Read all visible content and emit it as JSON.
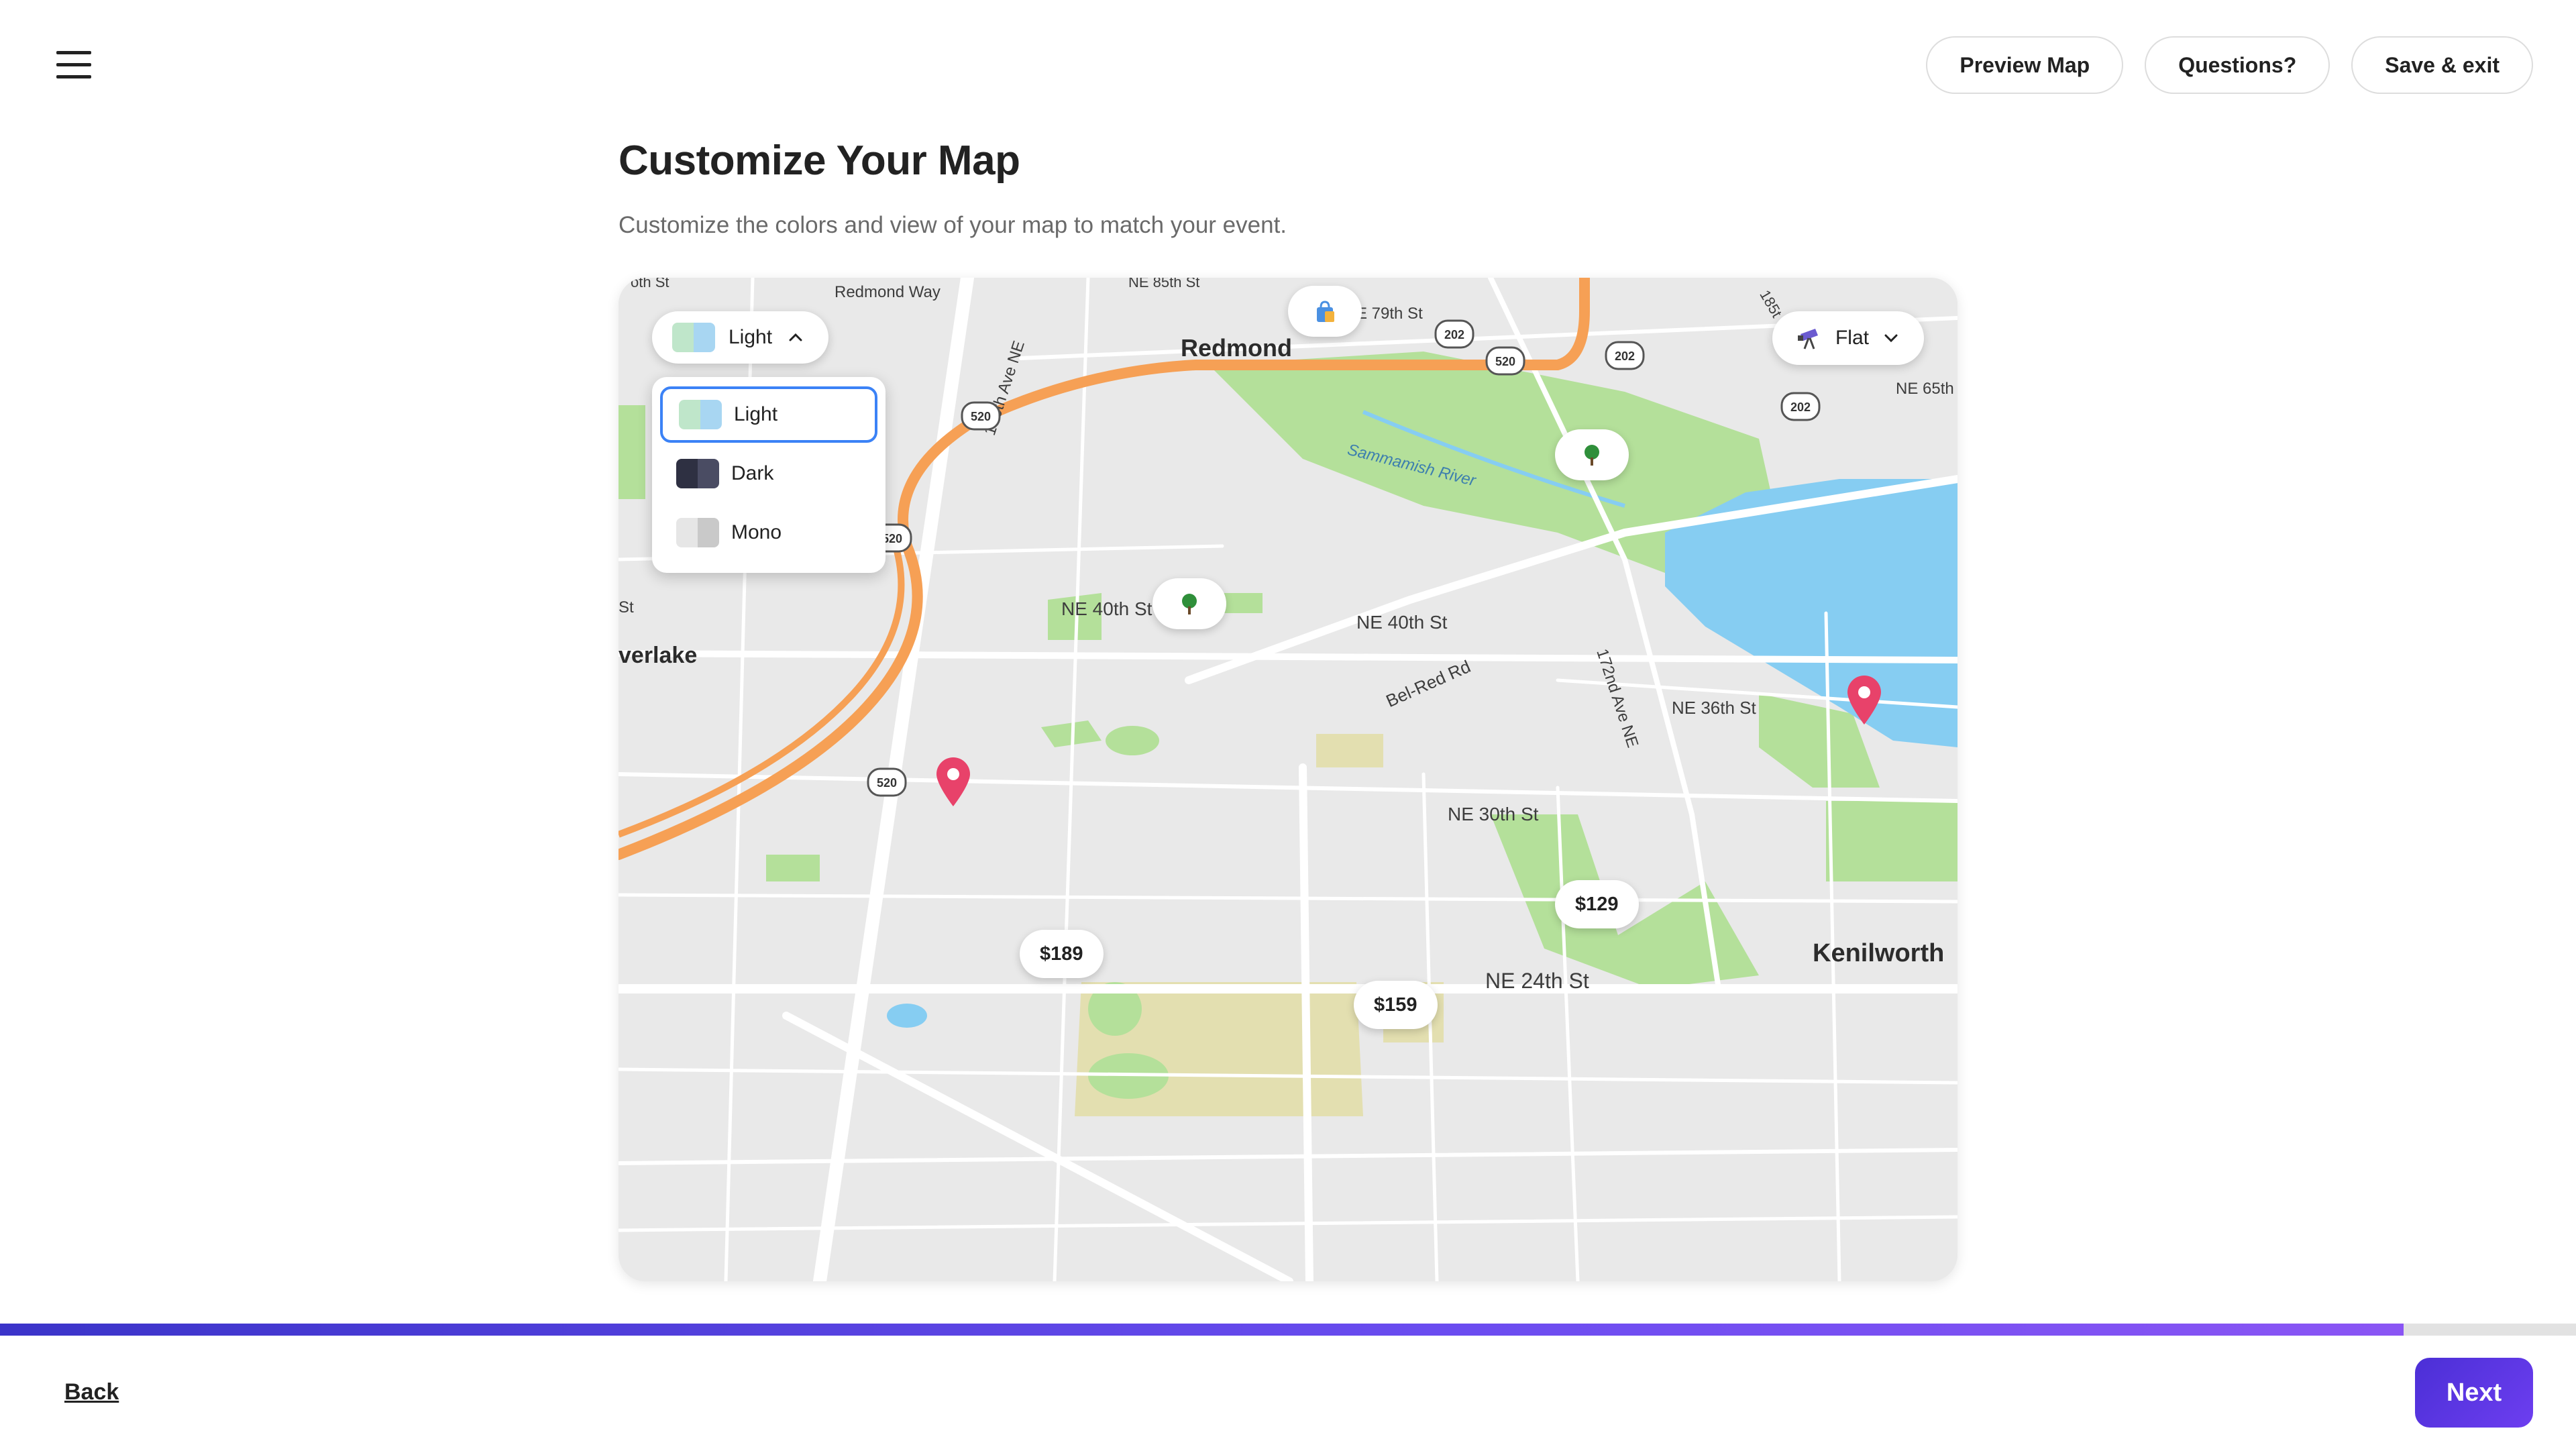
{
  "header": {
    "menu_icon": "hamburger-menu-icon",
    "actions": {
      "preview": "Preview Map",
      "questions": "Questions?",
      "save_exit": "Save & exit"
    }
  },
  "page": {
    "title": "Customize Your Map",
    "subtitle": "Customize the colors and view of your map to match your event."
  },
  "map_controls": {
    "style": {
      "selected": "Light",
      "options": [
        "Light",
        "Dark",
        "Mono"
      ],
      "open": true
    },
    "view": {
      "selected": "Flat",
      "icon": "telescope-icon"
    }
  },
  "map": {
    "labels": {
      "redmond": "Redmond",
      "redmond_way": "Redmond Way",
      "ne85th": "NE 85th St",
      "e79th": "E 79th St",
      "ne65th": "NE 65th",
      "r185": "185t",
      "st156": "156th Ave NE",
      "sammamish": "Sammamish River",
      "ne40th_a": "NE 40th St",
      "ne40th_b": "NE 40th St",
      "belred": "Bel-Red Rd",
      "ave172": "172nd Ave NE",
      "ne36th": "NE 36th St",
      "ne30th": "NE 30th St",
      "ne24th": "NE 24th St",
      "overlake": "verlake",
      "kenilworth": "Kenilworth",
      "st_edge": "St",
      "oth_st": "oth St"
    },
    "shields": [
      "520",
      "520",
      "520",
      "520",
      "202",
      "202",
      "202"
    ],
    "poi_icons": [
      "shopping-bag-icon",
      "tree-icon",
      "tree-icon"
    ],
    "prices": {
      "p189": "$189",
      "p129": "$129",
      "p159": "$159"
    },
    "colors": {
      "land": "#e9e9e9",
      "park": "#b4e09a",
      "water": "#86cdf2",
      "highway": "#f6a055",
      "pin": "#e8426a"
    }
  },
  "footer": {
    "back": "Back",
    "next": "Next",
    "progress": 0.933,
    "progress_color": "#5b3ee8"
  }
}
